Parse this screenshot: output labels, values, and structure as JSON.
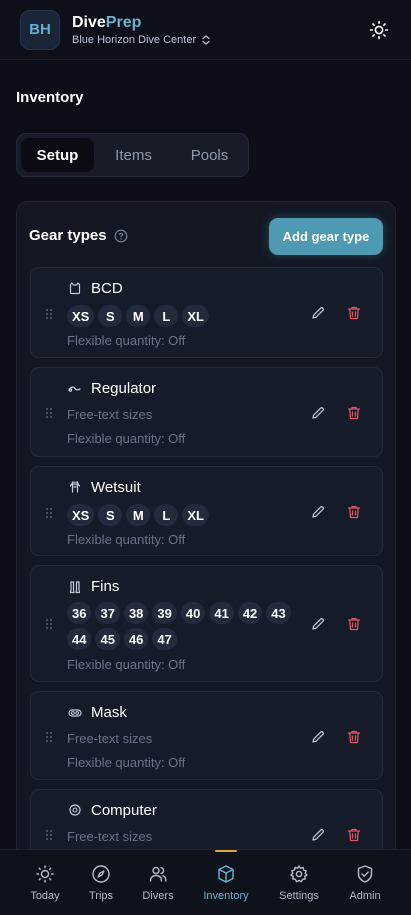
{
  "header": {
    "logo_initials": "BH",
    "brand_part1": "Dive",
    "brand_part2": "Prep",
    "org_name": "Blue Horizon Dive Center"
  },
  "page_title": "Inventory",
  "tabs": [
    {
      "label": "Setup",
      "active": true
    },
    {
      "label": "Items",
      "active": false
    },
    {
      "label": "Pools",
      "active": false
    }
  ],
  "panel": {
    "title": "Gear types",
    "add_button": "Add gear type"
  },
  "gear_types": [
    {
      "name": "BCD",
      "icon": "vest-icon",
      "sizes": [
        "XS",
        "S",
        "M",
        "L",
        "XL"
      ],
      "sizes_text": "",
      "flexible": "Flexible quantity: Off"
    },
    {
      "name": "Regulator",
      "icon": "regulator-icon",
      "sizes": [],
      "sizes_text": "Free-text sizes",
      "flexible": "Flexible quantity: Off"
    },
    {
      "name": "Wetsuit",
      "icon": "wetsuit-icon",
      "sizes": [
        "XS",
        "S",
        "M",
        "L",
        "XL"
      ],
      "sizes_text": "",
      "flexible": "Flexible quantity: Off"
    },
    {
      "name": "Fins",
      "icon": "fins-icon",
      "sizes": [
        "36",
        "37",
        "38",
        "39",
        "40",
        "41",
        "42",
        "43",
        "44",
        "45",
        "46",
        "47"
      ],
      "sizes_text": "",
      "flexible": "Flexible quantity: Off"
    },
    {
      "name": "Mask",
      "icon": "mask-icon",
      "sizes": [],
      "sizes_text": "Free-text sizes",
      "flexible": "Flexible quantity: Off"
    },
    {
      "name": "Computer",
      "icon": "computer-icon",
      "sizes": [],
      "sizes_text": "Free-text sizes",
      "flexible": ""
    }
  ],
  "nav": [
    {
      "label": "Today",
      "icon": "sun-icon"
    },
    {
      "label": "Trips",
      "icon": "compass-icon"
    },
    {
      "label": "Divers",
      "icon": "users-icon"
    },
    {
      "label": "Inventory",
      "icon": "box-icon"
    },
    {
      "label": "Settings",
      "icon": "gear-icon"
    },
    {
      "label": "Admin",
      "icon": "shield-icon"
    }
  ],
  "colors": {
    "accent": "#6ab4d2",
    "primary_button": "#4f9ab3",
    "danger": "#e05563",
    "active_indicator": "#e0a43c"
  }
}
